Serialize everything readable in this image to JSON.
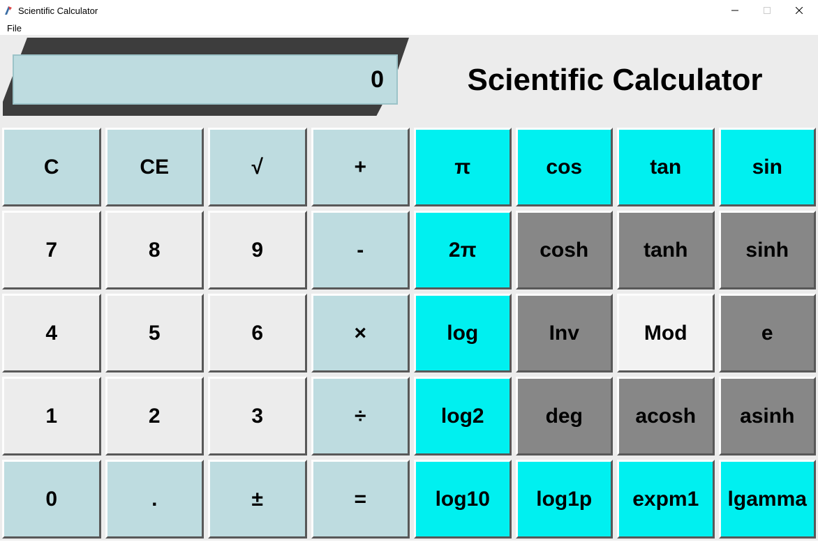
{
  "window": {
    "title": "Scientific Calculator"
  },
  "menubar": {
    "file": "File"
  },
  "display": {
    "value": "0"
  },
  "heading": "Scientific Calculator",
  "buttons": {
    "r0": {
      "c0": "C",
      "c1": "CE",
      "c2": "√",
      "c3": "+",
      "c4": "π",
      "c5": "cos",
      "c6": "tan",
      "c7": "sin"
    },
    "r1": {
      "c0": "7",
      "c1": "8",
      "c2": "9",
      "c3": "-",
      "c4": "2π",
      "c5": "cosh",
      "c6": "tanh",
      "c7": "sinh"
    },
    "r2": {
      "c0": "4",
      "c1": "5",
      "c2": "6",
      "c3": "×",
      "c4": "log",
      "c5": "Inv",
      "c6": "Mod",
      "c7": "e"
    },
    "r3": {
      "c0": "1",
      "c1": "2",
      "c2": "3",
      "c3": "÷",
      "c4": "log2",
      "c5": "deg",
      "c6": "acosh",
      "c7": "asinh"
    },
    "r4": {
      "c0": "0",
      "c1": ".",
      "c2": "±",
      "c3": "=",
      "c4": "log10",
      "c5": "log1p",
      "c6": "expm1",
      "c7": "lgamma"
    }
  }
}
